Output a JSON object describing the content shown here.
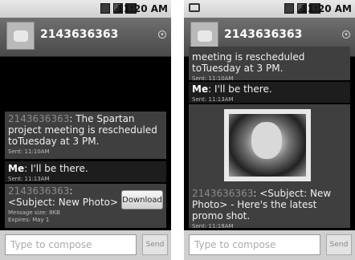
{
  "status_bar": {
    "time": "11:20 AM"
  },
  "contact": {
    "number": "2143636363"
  },
  "left": {
    "messages": [
      {
        "sender": "2143636363",
        "text": ": The Spartan project meeting is rescheduled toTuesday at 3 PM.",
        "meta": "Sent: 11:10AM"
      },
      {
        "sender": "Me",
        "text": ": I'll be there.",
        "meta": "Sent: 11:13AM"
      },
      {
        "sender": "2143636363",
        "text": ": <Subject: New Photo>",
        "meta1": "Message size: 8KB",
        "meta2": "Expires: May 1",
        "download_label": "Download"
      }
    ]
  },
  "right": {
    "messages": [
      {
        "text": "meeting is rescheduled toTuesday at 3 PM.",
        "meta": "Sent: 11:10AM"
      },
      {
        "sender": "Me",
        "text": ": I'll be there.",
        "meta": "Sent: 11:13AM"
      },
      {
        "sender": "2143636363",
        "text": ": <Subject: New Photo> - Here's the latest promo shot.",
        "meta": "Sent: 11:18AM"
      }
    ]
  },
  "compose": {
    "placeholder": "Type to compose",
    "send_label": "Send"
  }
}
